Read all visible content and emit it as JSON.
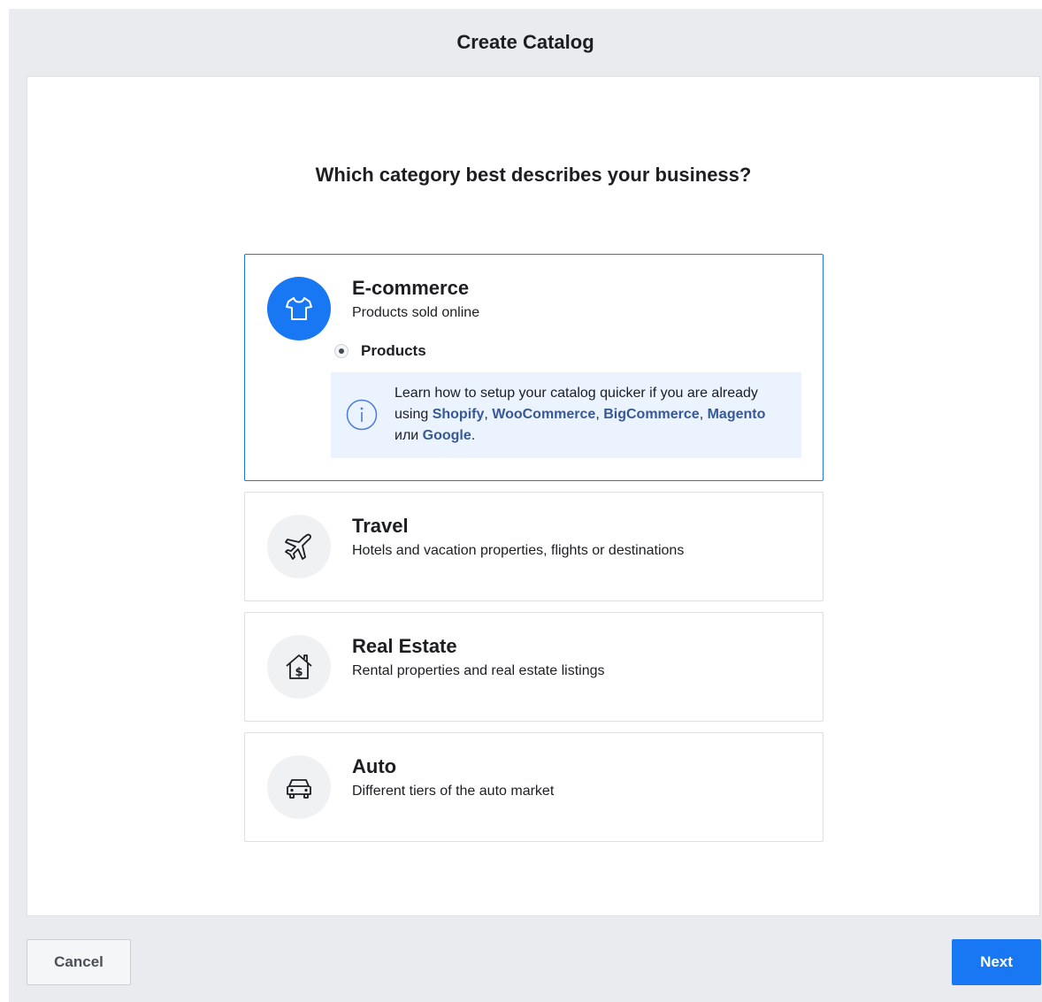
{
  "dialog": {
    "title": "Create Catalog",
    "question": "Which category best describes your business?"
  },
  "categories": [
    {
      "id": "ecommerce",
      "title": "E-commerce",
      "description": "Products sold online",
      "icon": "tshirt-icon",
      "selected": true,
      "options": [
        {
          "label": "Products",
          "selected": true
        }
      ],
      "info": {
        "text_before": "Learn how to setup your catalog quicker if you are already using ",
        "links": [
          "Shopify",
          "WooCommerce",
          "BigCommerce",
          "Magento",
          "Google"
        ],
        "sep1": ", ",
        "sep2": ", ",
        "sep3": ", ",
        "connector": " или ",
        "end": "."
      }
    },
    {
      "id": "travel",
      "title": "Travel",
      "description": "Hotels and vacation properties, flights or destinations",
      "icon": "airplane-icon",
      "selected": false
    },
    {
      "id": "real-estate",
      "title": "Real Estate",
      "description": "Rental properties and real estate listings",
      "icon": "house-dollar-icon",
      "selected": false
    },
    {
      "id": "auto",
      "title": "Auto",
      "description": "Different tiers of the auto market",
      "icon": "car-icon",
      "selected": false
    }
  ],
  "footer": {
    "cancel_label": "Cancel",
    "next_label": "Next"
  },
  "colors": {
    "accent": "#1877f2",
    "link": "#385898",
    "info_bg": "#eaf3fe",
    "frame_bg": "#e9ebee"
  }
}
